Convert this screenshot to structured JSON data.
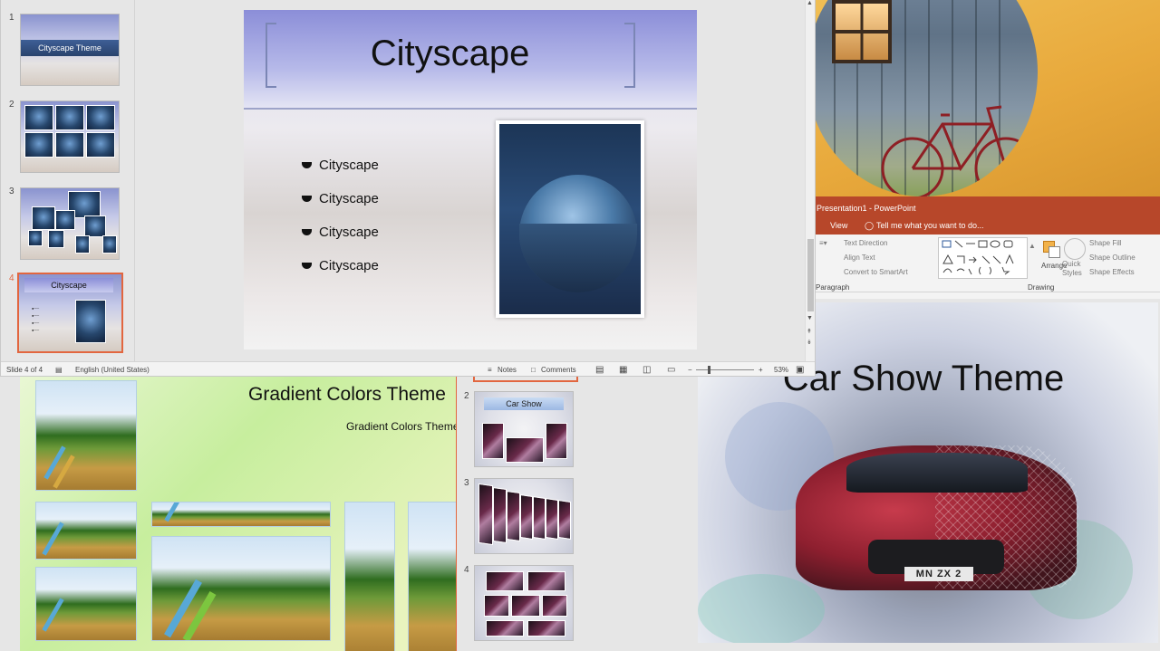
{
  "main_window": {
    "thumbnails": [
      {
        "number": "1",
        "caption": "Cityscape Theme"
      },
      {
        "number": "2",
        "caption": ""
      },
      {
        "number": "3",
        "caption": ""
      },
      {
        "number": "4",
        "caption": "Cityscape"
      }
    ],
    "slide": {
      "title": "Cityscape",
      "bullets": [
        "Cityscape",
        "Cityscape",
        "Cityscape",
        "Cityscape"
      ]
    },
    "status": {
      "slide_info": "Slide 4 of 4",
      "language": "English (United States)",
      "notes": "Notes",
      "comments": "Comments",
      "zoom": "53%"
    }
  },
  "top_right_window": {
    "title": "Presentation1 - PowerPoint",
    "tab_view": "View",
    "tell_me": "Tell me what you want to do...",
    "ribbon": {
      "text_direction": "Text Direction",
      "align_text": "Align Text",
      "convert_smartart": "Convert to SmartArt",
      "paragraph_label": "Paragraph",
      "arrange": "Arrange",
      "quick_styles_1": "Quick",
      "quick_styles_2": "Styles",
      "shape_fill": "Shape Fill",
      "shape_outline": "Shape Outline",
      "shape_effects": "Shape Effects",
      "drawing_label": "Drawing"
    }
  },
  "gradient_window": {
    "title": "Gradient Colors Theme",
    "subtitle": "Gradient Colors Theme"
  },
  "car_thumbs": [
    {
      "number": "2",
      "caption": "Car Show"
    },
    {
      "number": "3",
      "caption": ""
    },
    {
      "number": "4",
      "caption": ""
    }
  ],
  "car_window": {
    "title": "Car Show Theme",
    "plate": "MN ZX 2"
  },
  "colors": {
    "accent": "#b7472a",
    "selection": "#e2663f"
  }
}
